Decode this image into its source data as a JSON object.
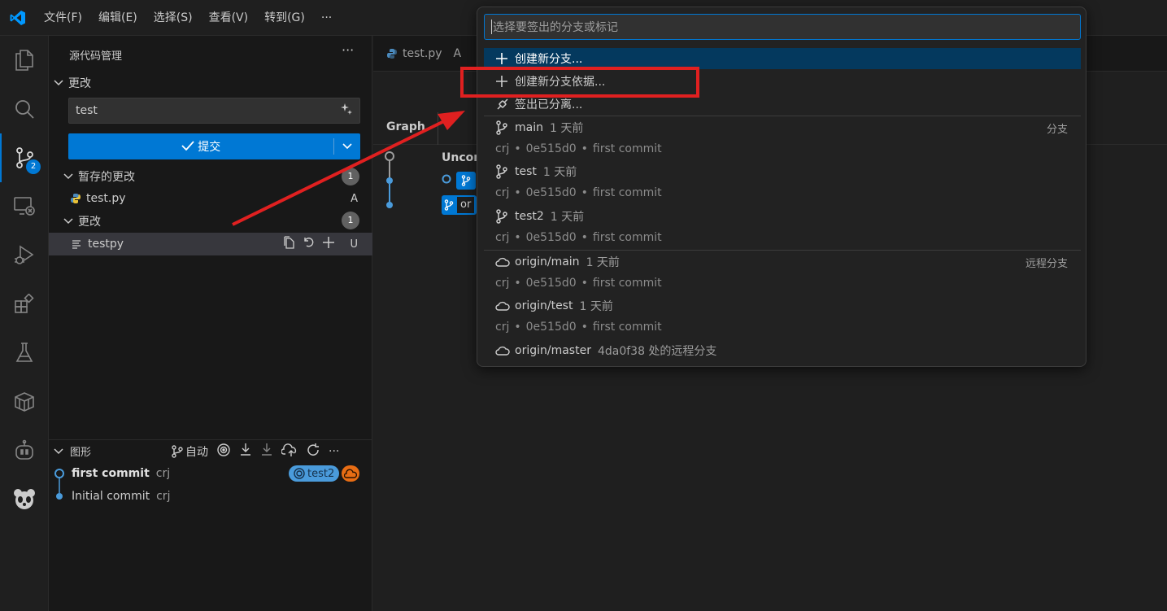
{
  "titlebar": {
    "menu": [
      "文件(F)",
      "编辑(E)",
      "选择(S)",
      "查看(V)",
      "转到(G)",
      "···"
    ]
  },
  "activitybar": {
    "badge": "2"
  },
  "sidebar": {
    "title": "源代码管理",
    "more": "···",
    "changes_header": "更改",
    "message_value": "test",
    "commit_label": "提交",
    "staged_header": "暂存的更改",
    "staged_count": "1",
    "staged_file": {
      "name": "test.py",
      "status": "A"
    },
    "unstaged_header": "更改",
    "unstaged_count": "1",
    "unstaged_file": {
      "name": "testpy",
      "status": "U"
    },
    "graph_header": "图形",
    "graph_auto": "自动",
    "commits": [
      {
        "message": "first commit",
        "author": "crj",
        "tag": "test2"
      },
      {
        "message": "Initial commit",
        "author": "crj"
      }
    ]
  },
  "editor": {
    "tab_name": "test.py",
    "tab_status": "A",
    "graph_column": "Graph",
    "uncommitted": "Uncom",
    "truncated_label": "or"
  },
  "quickpick": {
    "placeholder": "选择要签出的分支或标记",
    "actions": [
      "创建新分支...",
      "创建新分支依据...",
      "签出已分离..."
    ],
    "branch_group": "分支",
    "remote_group": "远程分支",
    "branches": [
      {
        "name": "main",
        "time": "1 天前",
        "author": "crj",
        "hash": "0e515d0",
        "msg": "first commit"
      },
      {
        "name": "test",
        "time": "1 天前",
        "author": "crj",
        "hash": "0e515d0",
        "msg": "first commit"
      },
      {
        "name": "test2",
        "time": "1 天前",
        "author": "crj",
        "hash": "0e515d0",
        "msg": "first commit"
      }
    ],
    "remotes": [
      {
        "name": "origin/main",
        "time": "1 天前",
        "author": "crj",
        "hash": "0e515d0",
        "msg": "first commit"
      },
      {
        "name": "origin/test",
        "time": "1 天前",
        "author": "crj",
        "hash": "0e515d0",
        "msg": "first commit"
      },
      {
        "name": "origin/master",
        "time": "4da0f38 处的远程分支"
      }
    ],
    "sep": "•"
  },
  "colors": {
    "accent": "#0078d4",
    "annotation": "#e02020",
    "focused_row": "#04395e"
  }
}
